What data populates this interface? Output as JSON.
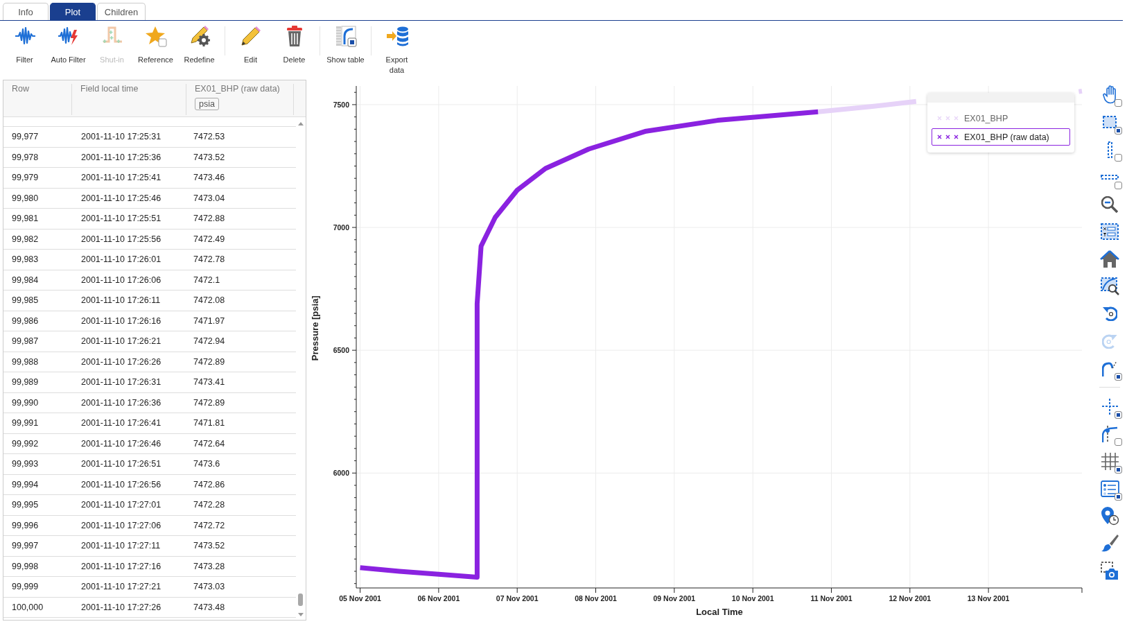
{
  "tabs": [
    {
      "label": "Info",
      "selected": false
    },
    {
      "label": "Plot",
      "selected": true
    },
    {
      "label": "Children",
      "selected": false
    }
  ],
  "toolbar": {
    "groups": [
      [
        {
          "label": "Filter",
          "disabled": false
        },
        {
          "label": "Auto Filter",
          "disabled": false
        },
        {
          "label": "Shut-in",
          "disabled": true
        },
        {
          "label": "Reference",
          "disabled": false
        },
        {
          "label": "Redefine",
          "disabled": false
        }
      ],
      [
        {
          "label": "Edit",
          "disabled": false
        },
        {
          "label": "Delete",
          "disabled": false
        }
      ],
      [
        {
          "label": "Show table",
          "disabled": false
        }
      ],
      [
        {
          "label": "Export data",
          "disabled": false
        }
      ]
    ]
  },
  "table": {
    "columns": [
      {
        "label": "Row"
      },
      {
        "label": "Field local time"
      },
      {
        "label": "EX01_BHP (raw data)",
        "unit": "psia"
      }
    ],
    "rows": [
      [
        "99,977",
        "2001-11-10 17:25:31",
        "7472.53"
      ],
      [
        "99,978",
        "2001-11-10 17:25:36",
        "7473.52"
      ],
      [
        "99,979",
        "2001-11-10 17:25:41",
        "7473.46"
      ],
      [
        "99,980",
        "2001-11-10 17:25:46",
        "7473.04"
      ],
      [
        "99,981",
        "2001-11-10 17:25:51",
        "7472.88"
      ],
      [
        "99,982",
        "2001-11-10 17:25:56",
        "7472.49"
      ],
      [
        "99,983",
        "2001-11-10 17:26:01",
        "7472.78"
      ],
      [
        "99,984",
        "2001-11-10 17:26:06",
        "7472.1"
      ],
      [
        "99,985",
        "2001-11-10 17:26:11",
        "7472.08"
      ],
      [
        "99,986",
        "2001-11-10 17:26:16",
        "7471.97"
      ],
      [
        "99,987",
        "2001-11-10 17:26:21",
        "7472.94"
      ],
      [
        "99,988",
        "2001-11-10 17:26:26",
        "7472.89"
      ],
      [
        "99,989",
        "2001-11-10 17:26:31",
        "7473.41"
      ],
      [
        "99,990",
        "2001-11-10 17:26:36",
        "7472.89"
      ],
      [
        "99,991",
        "2001-11-10 17:26:41",
        "7471.81"
      ],
      [
        "99,992",
        "2001-11-10 17:26:46",
        "7472.64"
      ],
      [
        "99,993",
        "2001-11-10 17:26:51",
        "7473.6"
      ],
      [
        "99,994",
        "2001-11-10 17:26:56",
        "7472.86"
      ],
      [
        "99,995",
        "2001-11-10 17:27:01",
        "7472.28"
      ],
      [
        "99,996",
        "2001-11-10 17:27:06",
        "7472.72"
      ],
      [
        "99,997",
        "2001-11-10 17:27:11",
        "7473.52"
      ],
      [
        "99,998",
        "2001-11-10 17:27:16",
        "7473.28"
      ],
      [
        "99,999",
        "2001-11-10 17:27:21",
        "7473.03"
      ],
      [
        "100,000",
        "2001-11-10 17:27:26",
        "7473.48"
      ]
    ]
  },
  "plot": {
    "legend": [
      {
        "muted": true,
        "selected": false
      },
      {
        "muted": false,
        "selected": true
      }
    ],
    "chart_data": {
      "type": "line",
      "grid": true,
      "legend": "upper right",
      "xlabel": "Local Time",
      "ylabel": "Pressure [psia]",
      "x": [
        "2001-11-05T00:00",
        "2001-11-05T12:00",
        "2001-11-06T00:00",
        "2001-11-06T11:46",
        "2001-11-06T11:46",
        "2001-11-06T12:58",
        "2001-11-06T17:17",
        "2001-11-07T00:00",
        "2001-11-07T08:38",
        "2001-11-07T21:50",
        "2001-11-08T15:22",
        "2001-11-09T13:12",
        "2001-11-10T19:55",
        "2001-11-11T12:00",
        "2001-11-12T01:55",
        "2001-11-14T03:36",
        "2001-11-14T04:34"
      ],
      "series": [
        {
          "name": "EX01_BHP",
          "color": "#e6d2f8",
          "values": [
            null,
            null,
            null,
            null,
            null,
            null,
            null,
            null,
            null,
            null,
            null,
            null,
            7471,
            7492,
            7513,
            7553,
            7555
          ]
        },
        {
          "name": "EX01_BHP (raw data)",
          "color": "#8a22e0",
          "values": [
            5615,
            5600,
            5588,
            5576,
            6690,
            6924,
            7041,
            7152,
            7240,
            7319,
            7392,
            7436,
            7471,
            null,
            null,
            null,
            null
          ]
        }
      ],
      "xlim": [
        "2001-11-04T23:02",
        "2001-11-14T04:34"
      ],
      "ylim": [
        5535,
        7576
      ],
      "xticks": [
        {
          "value": "2001-11-05T00:00",
          "label": "05 Nov 2001"
        },
        {
          "value": "2001-11-06T00:00",
          "label": "06 Nov 2001"
        },
        {
          "value": "2001-11-07T00:00",
          "label": "07 Nov 2001"
        },
        {
          "value": "2001-11-08T00:00",
          "label": "08 Nov 2001"
        },
        {
          "value": "2001-11-09T00:00",
          "label": "09 Nov 2001"
        },
        {
          "value": "2001-11-10T00:00",
          "label": "10 Nov 2001"
        },
        {
          "value": "2001-11-11T00:00",
          "label": "11 Nov 2001"
        },
        {
          "value": "2001-11-12T00:00",
          "label": "12 Nov 2001"
        },
        {
          "value": "2001-11-13T00:00",
          "label": "13 Nov 2001"
        }
      ],
      "yticks": [
        6000,
        6500,
        7000,
        7500
      ]
    }
  },
  "side_tools": [
    {
      "kind": "toggle",
      "active": false
    },
    {
      "kind": "toggle",
      "active": true
    },
    {
      "kind": "toggle",
      "active": false
    },
    {
      "kind": "toggle",
      "active": false
    },
    {
      "kind": "action"
    },
    {
      "kind": "action"
    },
    {
      "kind": "action"
    },
    {
      "kind": "action"
    },
    {
      "kind": "action",
      "disabled": false
    },
    {
      "kind": "action",
      "disabled": true
    },
    {
      "kind": "toggle",
      "active": true
    },
    {
      "kind": "toggle",
      "active": true
    },
    {
      "kind": "toggle",
      "active": false
    },
    {
      "kind": "toggle",
      "active": true
    },
    {
      "kind": "toggle",
      "active": true
    },
    {
      "kind": "action"
    },
    {
      "kind": "action"
    },
    {
      "kind": "action"
    }
  ]
}
